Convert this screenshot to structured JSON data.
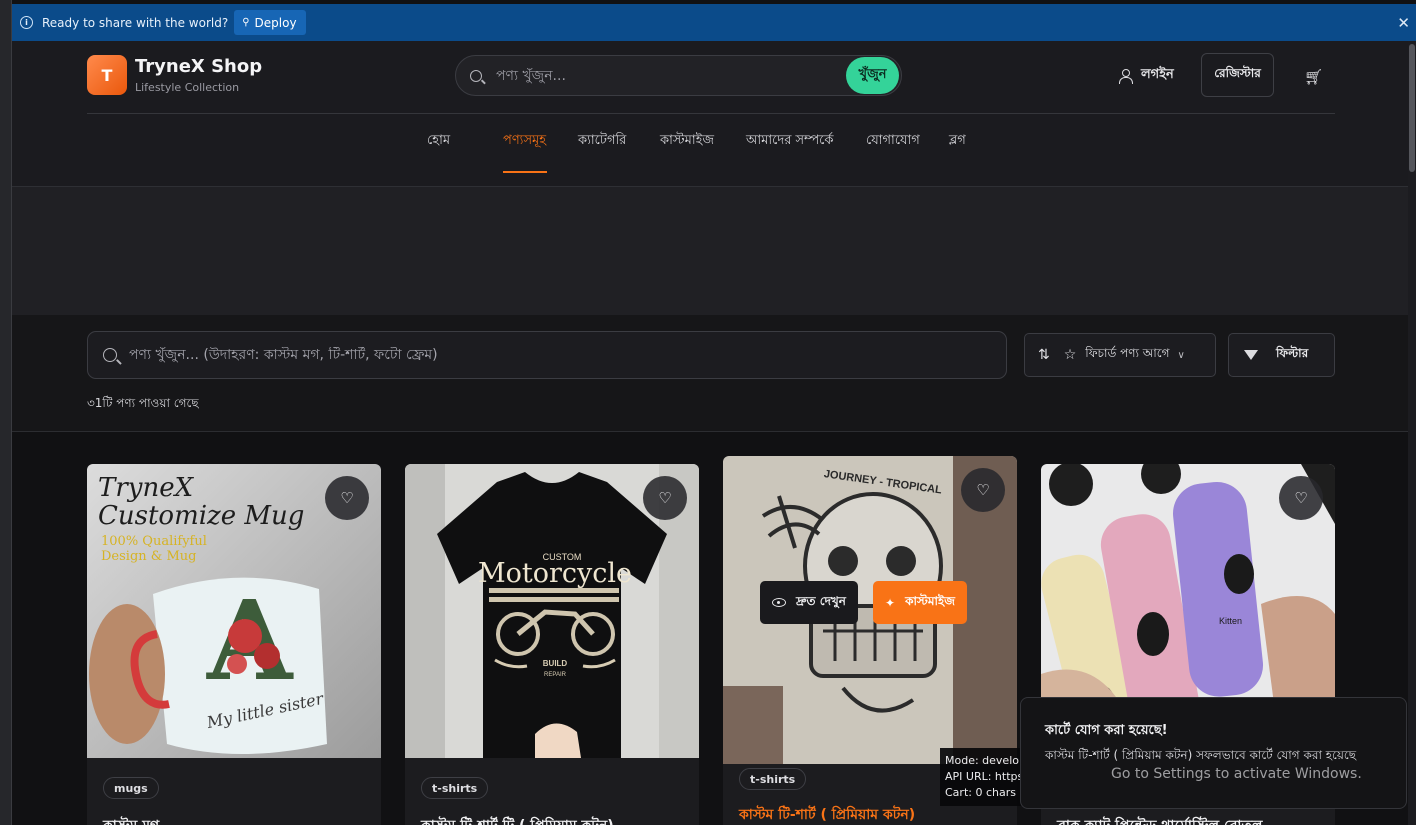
{
  "deploy_bar": {
    "message": "Ready to share with the world?",
    "deploy_label": "Deploy"
  },
  "header": {
    "logo_letter": "T",
    "brand_name": "TryneX Shop",
    "brand_tagline": "Lifestyle Collection",
    "search_placeholder": "পণ্য খুঁজুন...",
    "search_button": "খুঁজুন",
    "login_label": "লগইন",
    "register_label": "রেজিস্টার"
  },
  "nav": {
    "items": [
      {
        "label": "হোম",
        "active": false
      },
      {
        "label": "পণ্যসমূহ",
        "active": true
      },
      {
        "label": "ক্যাটেগরি",
        "active": false
      },
      {
        "label": "কাস্টমাইজ",
        "active": false
      },
      {
        "label": "আমাদের সম্পর্কে",
        "active": false
      },
      {
        "label": "যোগাযোগ",
        "active": false
      },
      {
        "label": "ব্লগ",
        "active": false
      }
    ]
  },
  "filters": {
    "search_placeholder": "পণ্য খুঁজুন... (উদাহরণ: কাস্টম মগ, টি-শার্ট, ফটো ফ্রেম)",
    "sort_label": "ফিচার্ড পণ্য আগে",
    "filter_label": "ফিল্টার",
    "result_count": "৩1টি পণ্য পাওয়া গেছে"
  },
  "products": [
    {
      "category": "mugs",
      "title": "কাস্টম মগ",
      "image_text": {
        "line1": "TryneX",
        "line2": "Customize Mug",
        "line3": "100% Qualifyful",
        "line4": "Design & Mug",
        "mug_letter": "A",
        "mug_script": "My little sister"
      }
    },
    {
      "category": "t-shirts",
      "title": "কাস্টম টি-শার্ট টি ( প্রিমিয়াম কটন)",
      "image_text": {
        "custom": "CUSTOM",
        "headline": "Motorcycle",
        "build": "BUILD",
        "repair": "REPAIR"
      }
    },
    {
      "category": "t-shirts",
      "title": "কাস্টম টি-শার্ট ( প্রিমিয়াম কটন)",
      "image_text": {
        "arc": "JOURNEY - TROPICAL"
      },
      "quick_view_label": "দ্রুত দেখুন",
      "customize_label": "কাস্টমাইজ"
    },
    {
      "category": "",
      "title": "ব্লাক ক্যাট প্রিন্টেড থার্মোস্টিল বোতল",
      "image_text": {
        "bottle_label": "Kitten"
      }
    }
  ],
  "dev_overlay": {
    "mode": "Mode: development",
    "api_url": "API URL: https://",
    "cart": "Cart: 0 chars"
  },
  "toast": {
    "title": "কার্টে যোগ করা হয়েছে!",
    "body": "কাস্টম টি-শার্ট ( প্রিমিয়াম কটন) সফলভাবে কার্টে যোগ করা হয়েছে"
  },
  "watermark": {
    "line2": "Go to Settings to activate Windows."
  },
  "colors": {
    "accent": "#f97316",
    "search_button": "#34d399",
    "deploy_bar": "#0b4b8a",
    "background": "#111113"
  }
}
